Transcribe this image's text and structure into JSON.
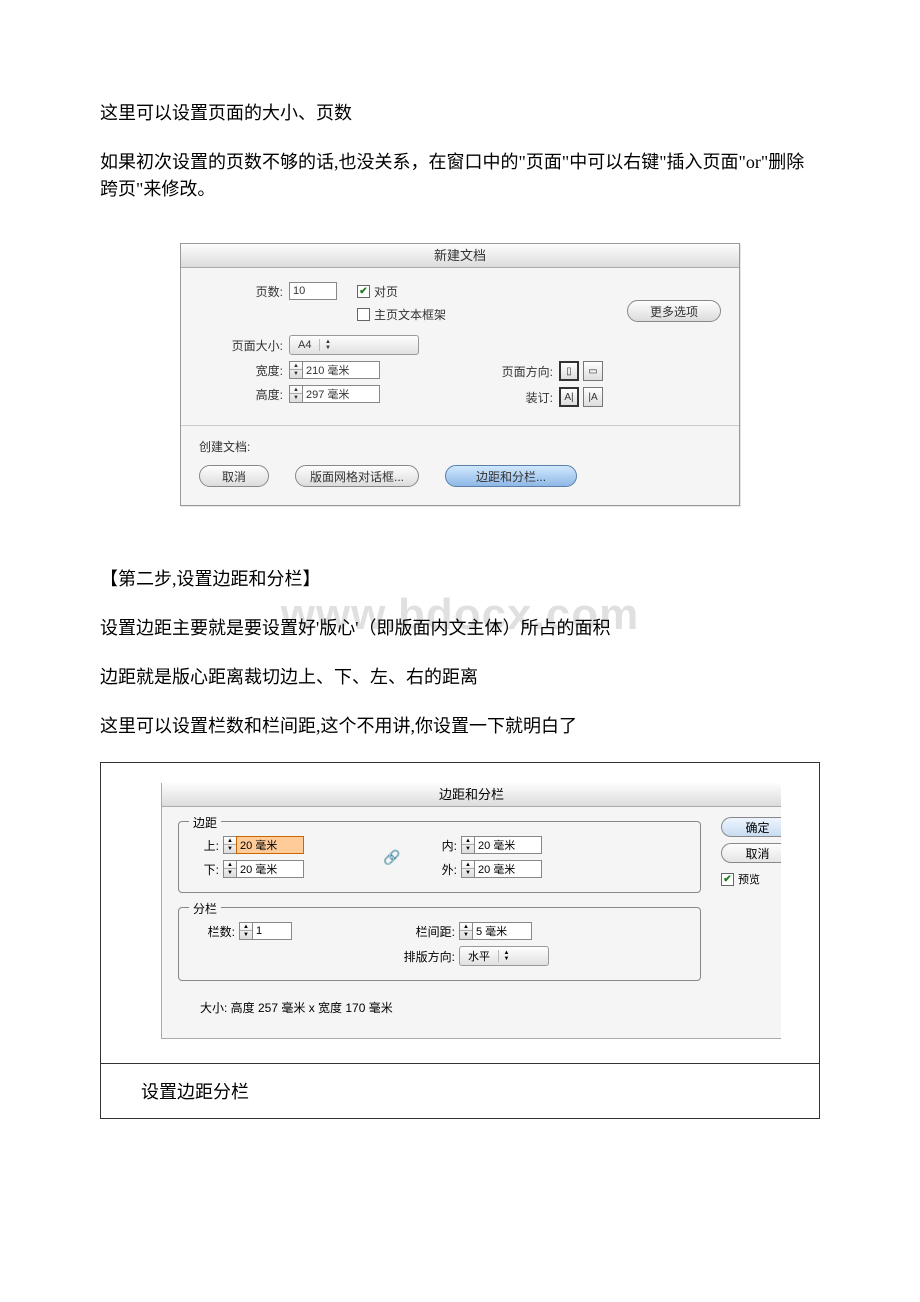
{
  "watermark": "www.bdocx.com",
  "intro": {
    "p1": "这里可以设置页面的大小、页数",
    "p2": "如果初次设置的页数不够的话,也没关系，在窗口中的\"页面\"中可以右键\"插入页面\"or\"删除跨页\"来修改。"
  },
  "dialog1": {
    "title": "新建文档",
    "pages_label": "页数:",
    "pages_value": "10",
    "facing_label": "对页",
    "master_label": "主页文本框架",
    "more_options": "更多选项",
    "page_size_label": "页面大小:",
    "page_size_value": "A4",
    "width_label": "宽度:",
    "width_value": "210 毫米",
    "height_label": "高度:",
    "height_value": "297 毫米",
    "orient_label": "页面方向:",
    "bind_label": "装订:",
    "create_label": "创建文档:",
    "cancel": "取消",
    "grid_btn": "版面网格对话框...",
    "margin_btn": "边距和分栏..."
  },
  "step2": {
    "h": "【第二步,设置边距和分栏】",
    "p1": "设置边距主要就是要设置好'版心'（即版面内文主体）所占的面积",
    "p2": "边距就是版心距离裁切边上、下、左、右的距离",
    "p3": "这里可以设置栏数和栏间距,这个不用讲,你设置一下就明白了"
  },
  "dialog2": {
    "title": "边距和分栏",
    "margin_legend": "边距",
    "top_label": "上:",
    "top_value": "20 毫米",
    "bottom_label": "下:",
    "bottom_value": "20 毫米",
    "inside_label": "内:",
    "inside_value": "20 毫米",
    "outside_label": "外:",
    "outside_value": "20 毫米",
    "col_legend": "分栏",
    "col_count_label": "栏数:",
    "col_count_value": "1",
    "gutter_label": "栏间距:",
    "gutter_value": "5 毫米",
    "direction_label": "排版方向:",
    "direction_value": "水平",
    "size_line": "大小:  高度 257 毫米 x 宽度 170 毫米",
    "ok": "确定",
    "cancel": "取消",
    "preview": "预览"
  },
  "caption2": "设置边距分栏"
}
